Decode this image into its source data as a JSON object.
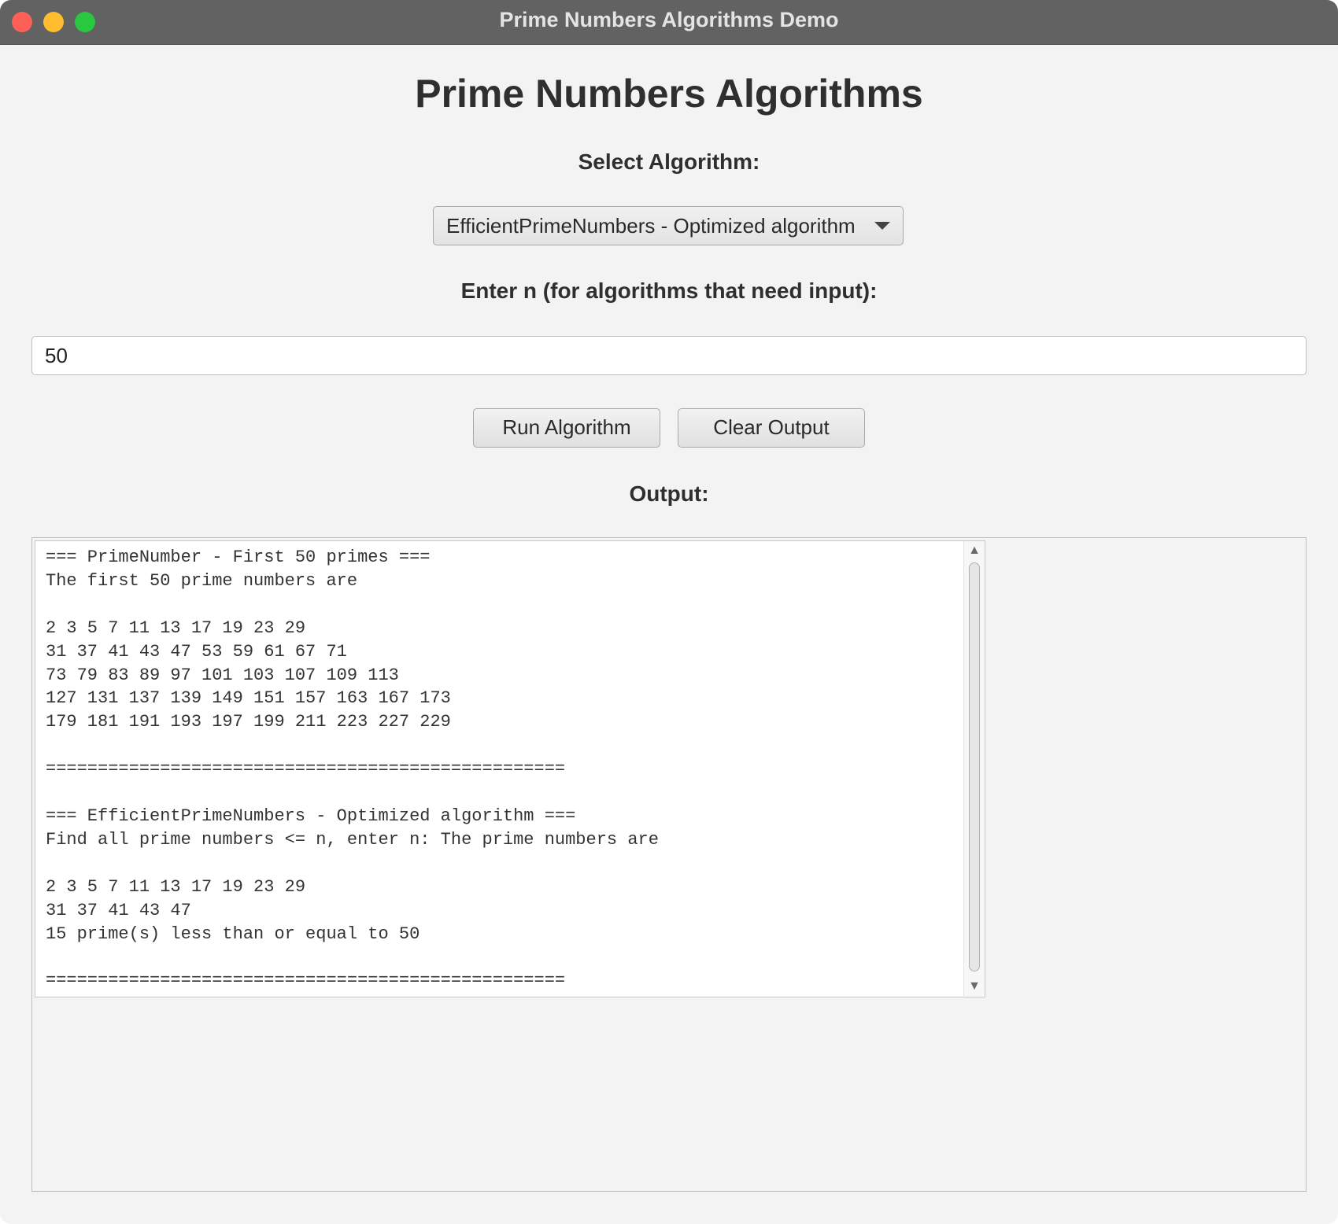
{
  "window": {
    "title": "Prime Numbers Algorithms Demo"
  },
  "main": {
    "title": "Prime Numbers Algorithms",
    "select_label": "Select Algorithm:",
    "selected_algorithm": "EfficientPrimeNumbers - Optimized algorithm",
    "input_label": "Enter n (for algorithms that need input):",
    "n_value": "50",
    "run_button": "Run Algorithm",
    "clear_button": "Clear Output",
    "output_label": "Output:"
  },
  "output": {
    "text": "=== PrimeNumber - First 50 primes ===\nThe first 50 prime numbers are\n\n2 3 5 7 11 13 17 19 23 29\n31 37 41 43 47 53 59 61 67 71\n73 79 83 89 97 101 103 107 109 113\n127 131 137 139 149 151 157 163 167 173\n179 181 191 193 197 199 211 223 227 229\n\n==================================================\n\n=== EfficientPrimeNumbers - Optimized algorithm ===\nFind all prime numbers <= n, enter n: The prime numbers are\n\n2 3 5 7 11 13 17 19 23 29\n31 37 41 43 47\n15 prime(s) less than or equal to 50\n\n=================================================="
  },
  "icons": {
    "scroll_up": "▲",
    "scroll_down": "▼"
  },
  "colors": {
    "close": "#fe5f57",
    "minimize": "#febc2e",
    "zoom": "#28c840",
    "titlebar": "#626262",
    "window_bg": "#f3f3f3"
  }
}
